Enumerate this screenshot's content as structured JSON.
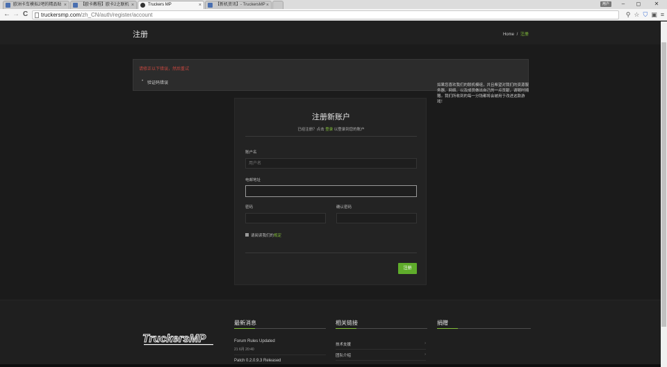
{
  "browser": {
    "tabs": [
      {
        "title": "欧洲卡车模拟2吧的精品贴",
        "active": false
      },
      {
        "title": "【欧卡教程】欧卡2之联机",
        "active": false
      },
      {
        "title": "Truckers MP",
        "active": true
      },
      {
        "title": "【新机资讯】- TruckersMP",
        "active": false
      }
    ],
    "user_badge": "用户",
    "window_buttons": {
      "minimize": "–",
      "maximize": "◻",
      "close": "✕"
    },
    "url_host": "truckersmp.com",
    "url_path": "/zh_CN/auth/register/account",
    "nav": {
      "back": "←",
      "forward": "→",
      "reload": "C"
    }
  },
  "header": {
    "title": "注册",
    "breadcrumb_home": "Home",
    "breadcrumb_sep": "/",
    "breadcrumb_current": "注册"
  },
  "alert": {
    "heading": "请修正以下错误，然后重试",
    "errors": [
      "验证码错误"
    ]
  },
  "form": {
    "title": "注册新账户",
    "subtitle_prefix": "已经注册？点击",
    "subtitle_link": "登录",
    "subtitle_suffix": "以登录到您的账户",
    "username_label": "账户名",
    "username_placeholder": "用户名",
    "email_label": "电邮地址",
    "email_value": "",
    "password_label": "密码",
    "confirm_label": "确认密码",
    "rules_prefix": "请阅读我们的",
    "rules_link": "规定",
    "submit_label": "注册"
  },
  "footer": {
    "logo_text": "TruckersMP",
    "news_title": "最新消息",
    "news": [
      {
        "title": "Forum Rules Updated",
        "date": "21 6月 20:40"
      },
      {
        "title": "Patch 0.2.0.9.3 Released",
        "date": ""
      }
    ],
    "links_title": "相关链接",
    "links": [
      "技术支援",
      "团队介绍"
    ],
    "donate_title": "捐赠",
    "donate_text": "如果您喜欢我们的联机模组，并且希望对我们的资源服务器、网络、以及成员做出自己的一点贡献，请随时捐赠。我们所收到的每一分钱都将会被用于改进这款游戏！"
  },
  "colors": {
    "accent": "#84c13b",
    "error": "#c7473f",
    "button": "#5fac2b"
  }
}
